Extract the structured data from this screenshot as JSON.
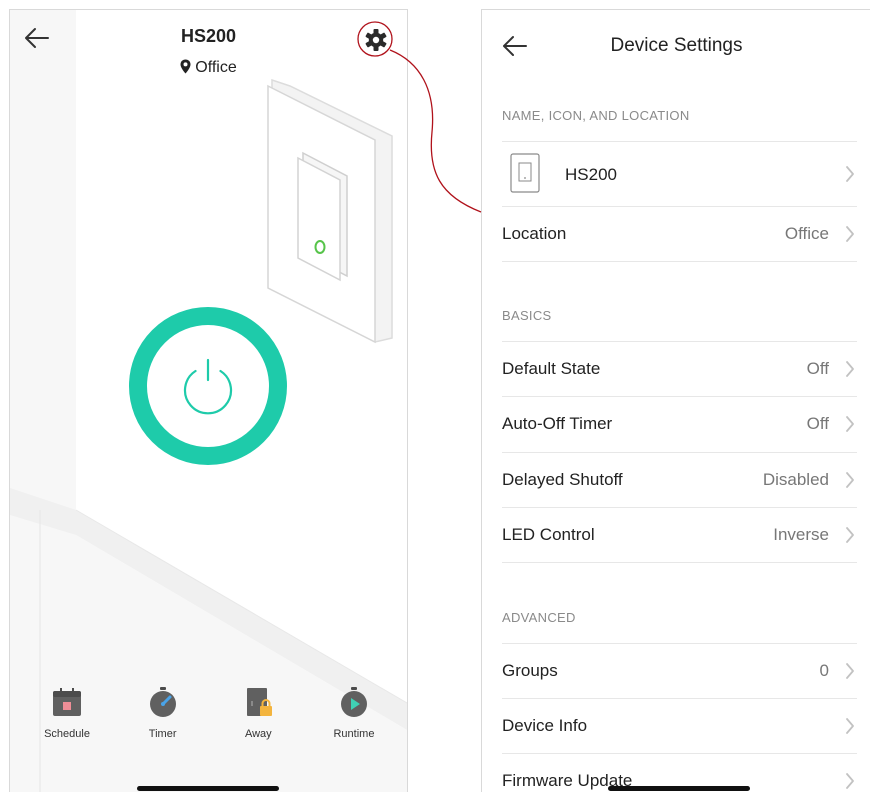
{
  "left_screen": {
    "device_name": "HS200",
    "location": "Office",
    "bottom_nav": [
      {
        "label": "Schedule",
        "icon": "calendar-icon"
      },
      {
        "label": "Timer",
        "icon": "stopwatch-icon"
      },
      {
        "label": "Away",
        "icon": "door-lock-icon"
      },
      {
        "label": "Runtime",
        "icon": "runtime-icon"
      }
    ]
  },
  "right_screen": {
    "title": "Device Settings",
    "sections": {
      "name_icon_location": "NAME, ICON, AND LOCATION",
      "basics": "BASICS",
      "advanced": "ADVANCED"
    },
    "device_row": {
      "label": "HS200"
    },
    "location_row": {
      "label": "Location",
      "value": "Office"
    },
    "basics_rows": [
      {
        "label": "Default State",
        "value": "Off"
      },
      {
        "label": "Auto-Off Timer",
        "value": "Off"
      },
      {
        "label": "Delayed Shutoff",
        "value": "Disabled"
      },
      {
        "label": "LED Control",
        "value": "Inverse"
      }
    ],
    "advanced_rows": [
      {
        "label": "Groups",
        "value": "0"
      },
      {
        "label": "Device Info",
        "value": ""
      },
      {
        "label": "Firmware Update",
        "value": ""
      }
    ]
  },
  "colors": {
    "power_ring": "#1ecbaa",
    "switch_led": "#57c44a",
    "callout": "#b0121b",
    "away_lock": "#f3b43e"
  }
}
